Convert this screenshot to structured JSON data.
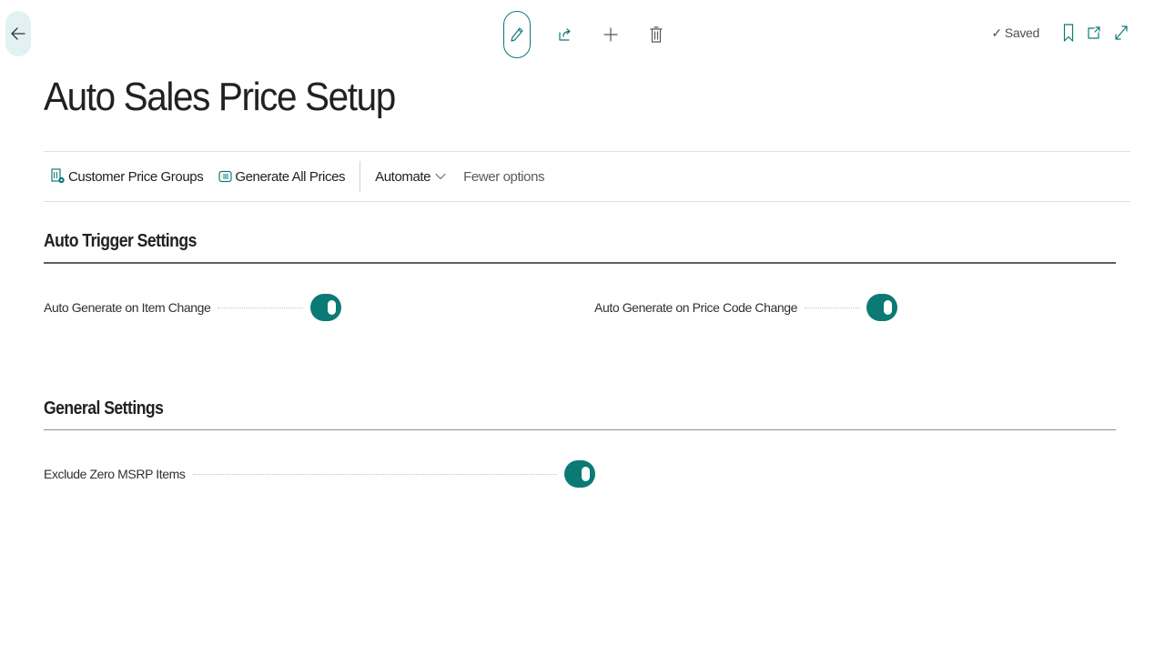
{
  "page": {
    "title": "Auto Sales Price Setup",
    "status": "Saved",
    "status_check": "✓"
  },
  "actions": {
    "customer_price_groups": "Customer Price Groups",
    "generate_all_prices": "Generate All Prices",
    "automate": "Automate",
    "fewer_options": "Fewer options"
  },
  "sections": {
    "auto_trigger": {
      "title": "Auto Trigger Settings",
      "auto_generate_item_change": {
        "label": "Auto Generate on Item Change",
        "value": true
      },
      "auto_generate_price_code_change": {
        "label": "Auto Generate on Price Code Change",
        "value": true
      }
    },
    "general": {
      "title": "General Settings",
      "exclude_zero_msrp": {
        "label": "Exclude Zero MSRP Items",
        "value": true
      }
    }
  },
  "colors": {
    "accent": "#0b7a75",
    "back_button_bg": "#e2f1f1",
    "text": "#212121"
  },
  "icons": {
    "back": "arrow-left-icon",
    "edit": "pencil-icon",
    "share": "share-icon",
    "new": "plus-icon",
    "delete": "trash-icon",
    "bookmark": "bookmark-icon",
    "open_new_window": "open-new-window-icon",
    "expand": "expand-icon"
  }
}
